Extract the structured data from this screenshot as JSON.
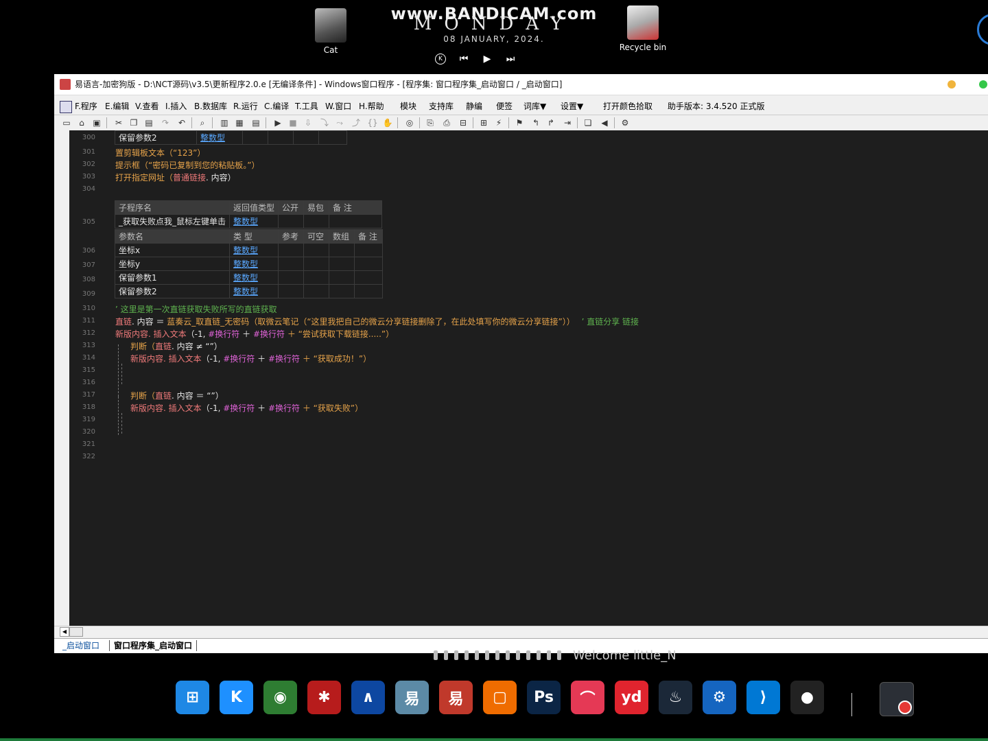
{
  "desktop": {
    "icons": [
      {
        "label": "Cat"
      },
      {
        "label": "Recycle bin"
      }
    ],
    "watermark": "www.BANDICAM.com",
    "clock": {
      "day": "MONDAY",
      "date": "08  JANUARY,  2024."
    },
    "media_controls": [
      "K",
      "⏮",
      "▶",
      "⏭"
    ]
  },
  "window": {
    "title": "易语言-加密狗版 - D:\\NCT源码\\v3.5\\更新程序2.0.e [无编译条件] - Windows窗口程序 - [程序集: 窗口程序集_启动窗口 / _启动窗口]",
    "menu": [
      "F.程序",
      "E.编辑",
      "V.查看",
      "I.插入",
      "B.数据库",
      "R.运行",
      "C.编译",
      "T.工具",
      "W.窗口",
      "H.帮助",
      "模块",
      "支持库",
      "静编",
      "便签",
      "词库▼",
      "设置▼",
      "打开颜色拾取",
      "助手版本: 3.4.520 正式版"
    ],
    "colors": {
      "editor_bg": "#1e1e1e",
      "keyword": "#e6a34a",
      "comment": "#5fb34f",
      "constant": "#e063d8",
      "type_link": "#5aa8ff"
    }
  },
  "editor": {
    "line_numbers": [
      "300",
      "301",
      "302",
      "303",
      "304",
      "305",
      "306",
      "307",
      "308",
      "309",
      "310",
      "311",
      "312",
      "313",
      "314",
      "315",
      "316",
      "317",
      "318",
      "319",
      "320",
      "321",
      "322"
    ],
    "row300": {
      "name": "保留参数2",
      "type": "整数型"
    },
    "line301": {
      "fn": "置剪辑板文本",
      "arg": "（“123”）"
    },
    "line302": {
      "fn": "提示框",
      "arg": "（“密码已复制到您的粘贴板。”）"
    },
    "line303": {
      "fn": "打开指定网址",
      "open": "（",
      "var": "普通链接",
      "rest": ". 内容）"
    },
    "sub_table": {
      "headers": [
        "子程序名",
        "返回值类型",
        "公开",
        "易包",
        "备 注"
      ],
      "name": "_获取失败点我_鼠标左键单击",
      "return_type": "整数型",
      "param_headers": [
        "参数名",
        "类 型",
        "参考",
        "可空",
        "数组",
        "备 注"
      ],
      "params": [
        {
          "name": "坐标x",
          "type": "整数型"
        },
        {
          "name": "坐标y",
          "type": "整数型"
        },
        {
          "name": "保留参数1",
          "type": "整数型"
        },
        {
          "name": "保留参数2",
          "type": "整数型"
        }
      ]
    },
    "line310": "’ 这里是第一次直链获取失败所写的直链获取",
    "line311": {
      "var": "直链",
      "prop": ". 内容",
      "op": " ＝ ",
      "fn": "蓝奏云_取直链_无密码",
      "arg1": "（取微云笔记（“这里我把自己的微云分享链接删除了，在此处填写你的微云分享链接”））",
      "comment": "’ 直链分享 链接"
    },
    "line312": {
      "obj": "新版内容. 插入文本",
      "a": "（-1, ",
      "c1": "#换行符",
      "plus": " ＋ ",
      "c2": "#换行符",
      "tail": " ＋ “尝试获取下载链接.....”）"
    },
    "line313": {
      "kw": "判断",
      "open": "（",
      "var": "直链",
      "rest": ". 内容 ≠ “”）"
    },
    "line314": {
      "obj": "新版内容. 插入文本",
      "a": "（-1, ",
      "c1": "#换行符",
      "plus": " ＋ ",
      "c2": "#换行符",
      "tail": " ＋ “获取成功！”）"
    },
    "line317": {
      "kw": "判断",
      "open": "（",
      "var": "直链",
      "rest": ". 内容 ＝ “”）"
    },
    "line318": {
      "obj": "新版内容. 插入文本",
      "a": "（-1, ",
      "c1": "#换行符",
      "plus": " ＋ ",
      "c2": "#换行符",
      "tail": " ＋ “获取失败”）"
    }
  },
  "tabs": [
    "_启动窗口",
    "窗口程序集_启动窗口"
  ],
  "welcome": "Welcome little_N",
  "taskbar": [
    {
      "icon": "windows-icon",
      "glyph": "⊞",
      "color": "#1e88e5"
    },
    {
      "icon": "k-app-icon",
      "glyph": "K",
      "color": "#1e90ff"
    },
    {
      "icon": "download-manager-icon",
      "glyph": "◉",
      "color": "#2e7d32"
    },
    {
      "icon": "asterisk-app-icon",
      "glyph": "✱",
      "color": "#b71c1c"
    },
    {
      "icon": "wave-app-icon",
      "glyph": "∧",
      "color": "#0d47a1"
    },
    {
      "icon": "elang-blue-icon",
      "glyph": "易",
      "color": "#5c8aa6"
    },
    {
      "icon": "elang-red-icon",
      "glyph": "易",
      "color": "#c0392b"
    },
    {
      "icon": "window-app-icon",
      "glyph": "▢",
      "color": "#ef6c00"
    },
    {
      "icon": "photoshop-icon",
      "glyph": "Ps",
      "color": "#0b2545"
    },
    {
      "icon": "chart-app-icon",
      "glyph": "⌒",
      "color": "#e53955"
    },
    {
      "icon": "youdao-icon",
      "glyph": "yd",
      "color": "#e0242e"
    },
    {
      "icon": "steam-icon",
      "glyph": "♨",
      "color": "#1b2838"
    },
    {
      "icon": "gear-tool-icon",
      "glyph": "⚙",
      "color": "#1565c0"
    },
    {
      "icon": "vscode-icon",
      "glyph": "⟩",
      "color": "#0078d4"
    },
    {
      "icon": "qq-icon",
      "glyph": "●",
      "color": "#222"
    }
  ]
}
